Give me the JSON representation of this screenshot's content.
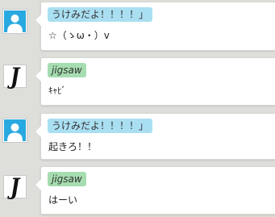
{
  "messages": [
    {
      "user": "うけみだよ！！！！」",
      "avatar": "default-user-icon",
      "tag_color": "#aadff2",
      "text": "☆（ゝω・）v"
    },
    {
      "user": "jigsaw",
      "avatar": "jigsaw-logo-icon",
      "tag_color": "#a6ddb0",
      "text": "ｷｬﾋﾞ"
    },
    {
      "user": "うけみだよ！！！！」",
      "avatar": "default-user-icon",
      "tag_color": "#aadff2",
      "text": "起きろ！！"
    },
    {
      "user": "jigsaw",
      "avatar": "jigsaw-logo-icon",
      "tag_color": "#a6ddb0",
      "text": "はーい"
    }
  ],
  "jigsaw_logo_letter": "J"
}
